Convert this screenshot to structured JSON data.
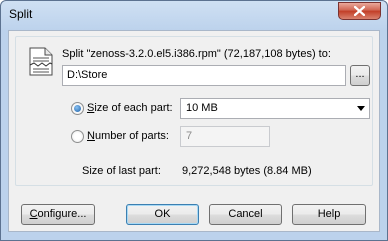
{
  "window": {
    "title": "Split"
  },
  "split": {
    "description": "Split \"zenoss-3.2.0.el5.i386.rpm\" (72,187,108 bytes) to:",
    "destination": "D:\\Store",
    "browse_label": "..."
  },
  "options": {
    "size_each_part": {
      "label_prefix": "S",
      "label_rest": "ize of each part:",
      "selected": true,
      "value": "10 MB"
    },
    "number_of_parts": {
      "label_prefix": "N",
      "label_rest": "umber of parts:",
      "selected": false,
      "value": "7"
    },
    "last_part": {
      "label": "Size of last part:",
      "value": "9,272,548 bytes (8.84 MB)"
    }
  },
  "buttons": {
    "configure_prefix": "C",
    "configure_rest": "onfigure...",
    "ok": "OK",
    "cancel": "Cancel",
    "help": "Help"
  },
  "colors": {
    "title_gradient_top": "#cfe0f3",
    "close_red": "#c23d26",
    "dialog_bg": "#f0f0f0",
    "default_button_border": "#3c7fb1"
  }
}
